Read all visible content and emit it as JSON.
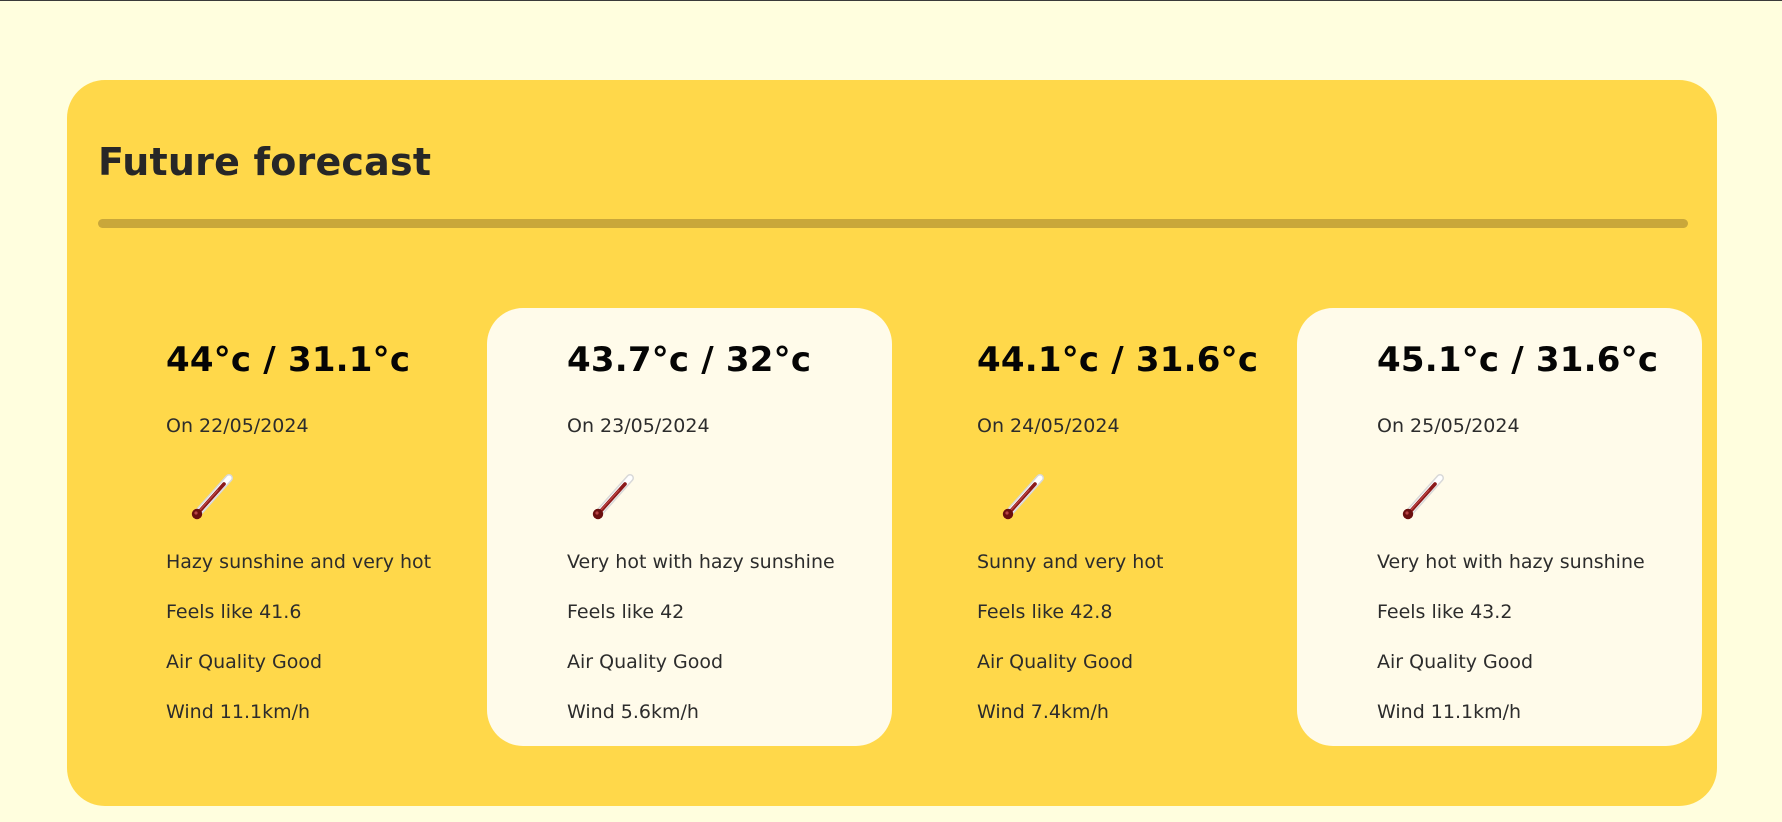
{
  "forecast": {
    "title": "Future forecast",
    "days": [
      {
        "temp": "44°c / 31.1°c",
        "date": "On 22/05/2024",
        "icon": "thermometer-icon",
        "condition": "Hazy sunshine and very hot",
        "feels_like": "Feels like 41.6",
        "air_quality": "Air Quality Good",
        "wind": "Wind 11.1km/h"
      },
      {
        "temp": "43.7°c / 32°c",
        "date": "On 23/05/2024",
        "icon": "thermometer-icon",
        "condition": "Very hot with hazy sunshine",
        "feels_like": "Feels like 42",
        "air_quality": "Air Quality Good",
        "wind": "Wind 5.6km/h"
      },
      {
        "temp": "44.1°c / 31.6°c",
        "date": "On 24/05/2024",
        "icon": "thermometer-icon",
        "condition": "Sunny and very hot",
        "feels_like": "Feels like 42.8",
        "air_quality": "Air Quality Good",
        "wind": "Wind 7.4km/h"
      },
      {
        "temp": "45.1°c / 31.6°c",
        "date": "On 25/05/2024",
        "icon": "thermometer-icon",
        "condition": "Very hot with hazy sunshine",
        "feels_like": "Feels like 43.2",
        "air_quality": "Air Quality Good",
        "wind": "Wind 11.1km/h"
      }
    ]
  },
  "colors": {
    "page_background": "#fffede",
    "panel_background": "#ffd84a",
    "divider": "#c9a73a",
    "card_highlight": "#fffbea",
    "thermometer": "#8b1a1a"
  }
}
